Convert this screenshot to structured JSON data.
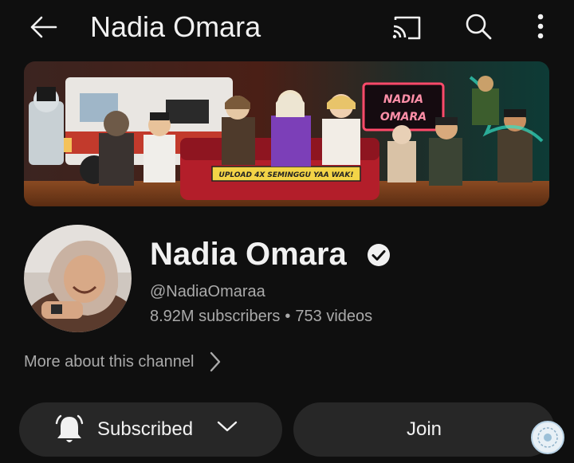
{
  "header": {
    "title": "Nadia Omara",
    "back_icon": "arrow-left-icon",
    "cast_icon": "cast-icon",
    "search_icon": "search-icon",
    "more_icon": "more-vertical-icon"
  },
  "banner": {
    "sign_text_line1": "NADIA",
    "sign_text_line2": "OMARA",
    "sofa_text": "UPLOAD 4X SEMINGGU YAA WAK!"
  },
  "channel": {
    "name": "Nadia Omara",
    "verified_icon": "verified-check-icon",
    "handle": "@NadiaOmaraa",
    "subscribers": "8.92M subscribers",
    "separator": "•",
    "videos": "753 videos",
    "more_about": "More about this channel"
  },
  "actions": {
    "subscribed_label": "Subscribed",
    "join_label": "Join"
  },
  "colors": {
    "background": "#0f0f0f",
    "button_bg": "#272727",
    "text_primary": "#f1f1f1",
    "text_secondary": "#aaaaaa"
  }
}
